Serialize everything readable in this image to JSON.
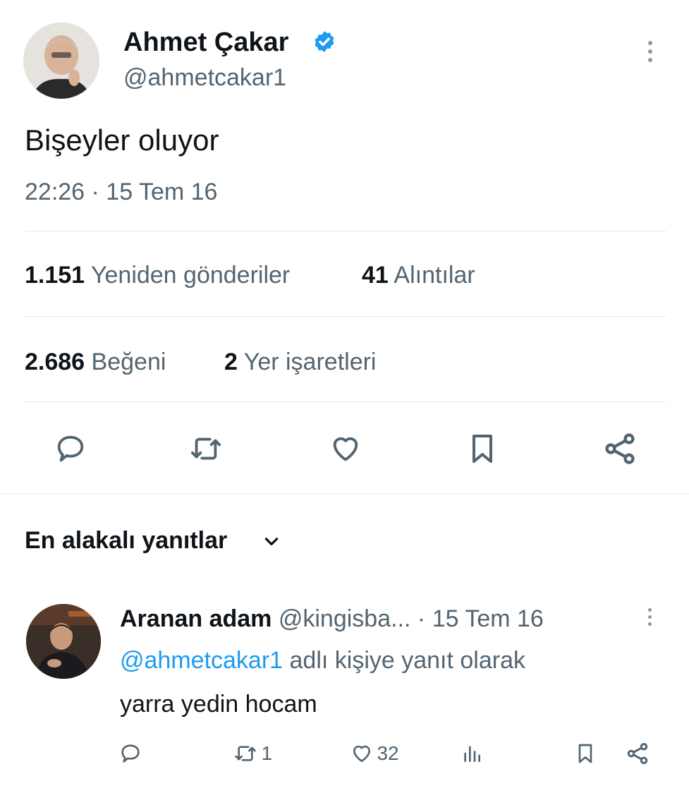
{
  "tweet": {
    "author_name": "Ahmet Çakar",
    "author_handle": "@ahmetcakar1",
    "verified_color": "#1d9bf0",
    "text": "Bişeyler oluyor",
    "timestamp": "22:26 · 15 Tem 16",
    "stats": {
      "reposts_count": "1.151",
      "reposts_label": "Yeniden gönderiler",
      "quotes_count": "41",
      "quotes_label": "Alıntılar",
      "likes_count": "2.686",
      "likes_label": "Beğeni",
      "bookmarks_count": "2",
      "bookmarks_label": "Yer işaretleri"
    },
    "actions": [
      "reply-icon",
      "repost-icon",
      "like-icon",
      "bookmark-icon",
      "share-icon"
    ]
  },
  "replies_section": {
    "sort_label": "En alakalı yanıtlar"
  },
  "reply": {
    "author_name": "Aranan adam",
    "author_handle": "@kingisba...",
    "date": "· 15 Tem 16",
    "reply_to_mention": "@ahmetcakar1",
    "reply_to_suffix": "adlı kişiye yanıt olarak",
    "text": "yarra yedin hocam",
    "mention_color": "#1d9bf0",
    "stats": {
      "reposts": "1",
      "likes": "32"
    }
  }
}
